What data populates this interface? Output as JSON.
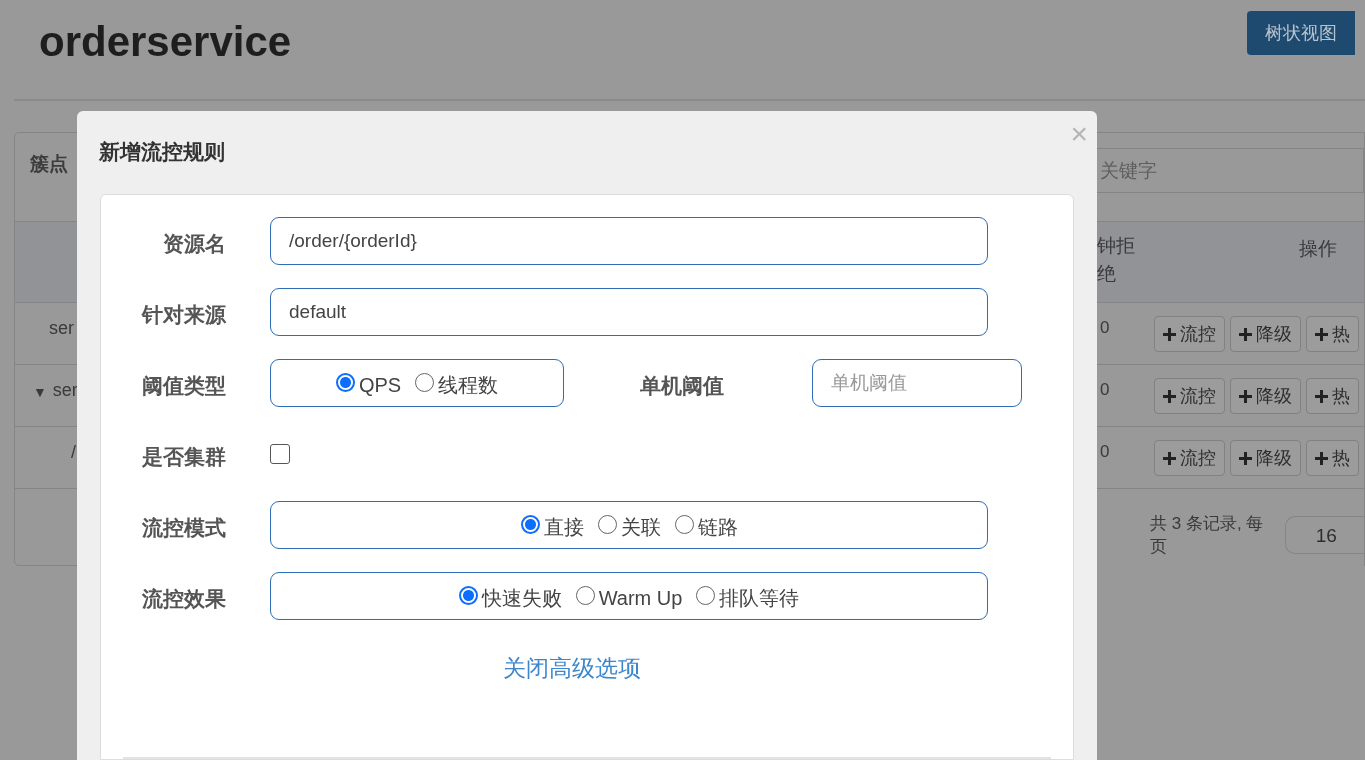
{
  "page_title": "orderservice",
  "view_button": {
    "label": "树状视图"
  },
  "cluster_card": {
    "title": "簇点",
    "search": {
      "placeholder": "关键字"
    },
    "columns": [
      {
        "label": "钟拒绝"
      },
      {
        "label": "操作"
      }
    ],
    "rows": [
      {
        "resource": "ser",
        "value": "0",
        "actions": [
          "流控",
          "降级",
          "热"
        ]
      },
      {
        "toggle": "▼",
        "resource": "ser",
        "value": "0",
        "actions": [
          "流控",
          "降级",
          "热"
        ]
      },
      {
        "resource": "/",
        "value": "0",
        "actions": [
          "流控",
          "降级",
          "热"
        ]
      }
    ],
    "pagination": {
      "summary": "共 3 条记录, 每页",
      "page_size": "16"
    }
  },
  "dialog": {
    "title": "新增流控规则",
    "close": "×",
    "fields": [
      {
        "kind": "text",
        "label": "资源名",
        "value": "/order/{orderId}"
      },
      {
        "kind": "text",
        "label": "针对来源",
        "value": "default"
      },
      {
        "kind": "radio_input",
        "label": "阈值类型",
        "options": [
          {
            "label": "QPS",
            "selected": true
          },
          {
            "label": "线程数",
            "selected": false
          }
        ],
        "side_label": "单机阈值",
        "side_placeholder": "单机阈值"
      },
      {
        "kind": "checkbox",
        "label": "是否集群",
        "checked": false
      },
      {
        "kind": "radio",
        "label": "流控模式",
        "options": [
          {
            "label": "直接",
            "selected": true
          },
          {
            "label": "关联",
            "selected": false
          },
          {
            "label": "链路",
            "selected": false
          }
        ]
      },
      {
        "kind": "radio",
        "label": "流控效果",
        "options": [
          {
            "label": "快速失败",
            "selected": true
          },
          {
            "label": "Warm Up",
            "selected": false
          },
          {
            "label": "排队等待",
            "selected": false
          }
        ]
      }
    ],
    "advanced_link": "关闭高级选项"
  }
}
